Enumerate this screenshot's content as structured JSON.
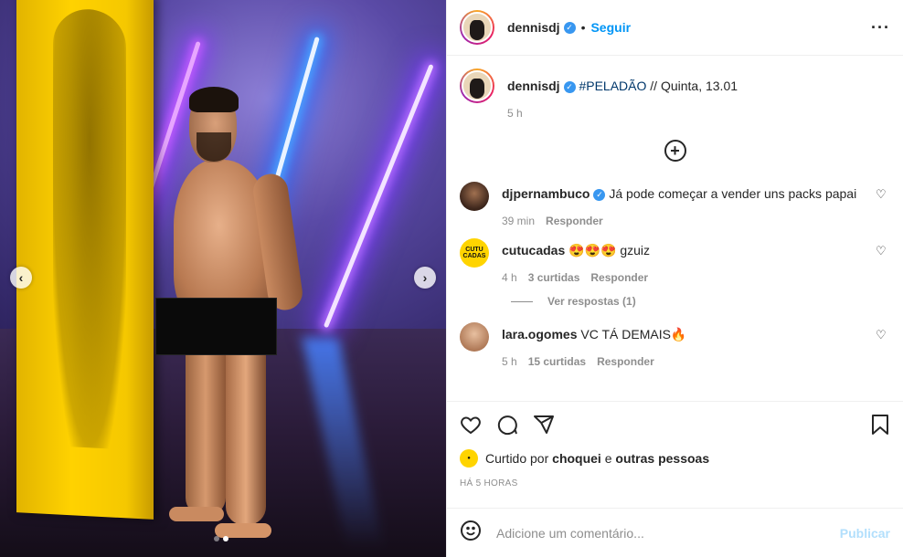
{
  "post": {
    "author": "dennisdj",
    "follow_label": "Seguir",
    "separator": "•",
    "more_icon": "more-horizontal-icon",
    "caption_text": "#PELADÃO // Quinta, 13.01",
    "caption_hashtag": "#PELADÃO",
    "caption_rest": "// Quinta, 13.01",
    "caption_time": "5 h",
    "load_more_icon": "plus-circle-icon"
  },
  "comments": [
    {
      "user": "djpernambuco",
      "verified": true,
      "text": "Já pode começar a vender uns packs papai",
      "time": "39 min",
      "likes": "",
      "reply": "Responder"
    },
    {
      "user": "cutucadas",
      "verified": false,
      "text": "😍😍😍 gzuiz",
      "time": "4 h",
      "likes": "3 curtidas",
      "reply": "Responder",
      "avatar_text": "CUTU CADAS"
    },
    {
      "user": "lara.ogomes",
      "verified": false,
      "text": "VC TÁ DEMAIS🔥",
      "time": "5 h",
      "likes": "15 curtidas",
      "reply": "Responder"
    }
  ],
  "view_replies": "Ver respostas (1)",
  "actions": {
    "like_icon": "heart-icon",
    "comment_icon": "comment-icon",
    "share_icon": "send-icon",
    "save_icon": "bookmark-icon"
  },
  "likes": {
    "prefix": "Curtido por",
    "user": "choquei",
    "connector": "e",
    "others": "outras pessoas"
  },
  "timestamp": "HÁ 5 HORAS",
  "add_comment": {
    "placeholder": "Adicione um comentário...",
    "publish_label": "Publicar"
  },
  "carousel": {
    "slides": 2,
    "current": 2
  },
  "colors": {
    "accent": "#0095f6",
    "verified": "#3897f0",
    "muted": "#8e8e8e",
    "publish_disabled": "#b2dffc"
  }
}
